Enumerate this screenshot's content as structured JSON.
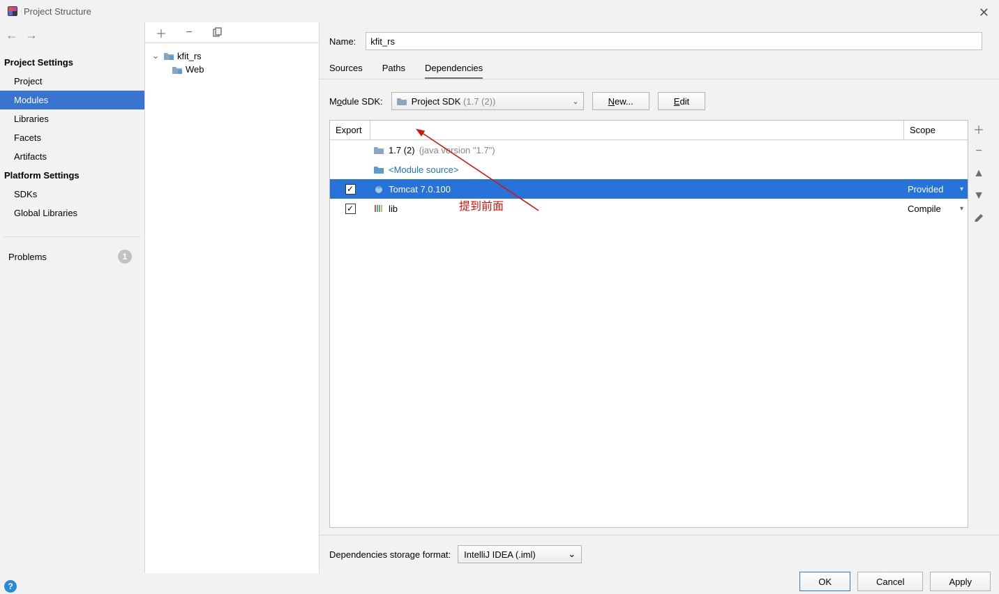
{
  "window": {
    "title": "Project Structure"
  },
  "sidebar": {
    "sections": [
      {
        "title": "Project Settings",
        "items": [
          "Project",
          "Modules",
          "Libraries",
          "Facets",
          "Artifacts"
        ],
        "selected": "Modules"
      },
      {
        "title": "Platform Settings",
        "items": [
          "SDKs",
          "Global Libraries"
        ]
      }
    ],
    "problems": {
      "label": "Problems",
      "count": "1"
    }
  },
  "tree": {
    "root": {
      "label": "kfit_rs",
      "children": [
        {
          "label": "Web"
        }
      ]
    }
  },
  "content": {
    "name_label": "Name:",
    "name_value": "kfit_rs",
    "tabs": [
      "Sources",
      "Paths",
      "Dependencies"
    ],
    "active_tab": "Dependencies",
    "sdk": {
      "label_pre": "M",
      "label_u": "o",
      "label_post": "dule SDK:",
      "select_main": "Project SDK ",
      "select_dim": "(1.7 (2))",
      "new_pre": "",
      "new_u": "N",
      "new_post": "ew...",
      "edit_pre": "",
      "edit_u": "E",
      "edit_post": "dit"
    },
    "dep_table": {
      "headers": {
        "export": "Export",
        "scope": "Scope"
      },
      "rows": [
        {
          "checked": false,
          "export_visible": false,
          "name_main": "1.7 (2) ",
          "name_dim": "(java version \"1.7\")",
          "scope": "",
          "selected": false,
          "link": false,
          "icon": "folder"
        },
        {
          "checked": false,
          "export_visible": false,
          "name_main": "<Module source>",
          "name_dim": "",
          "scope": "",
          "selected": false,
          "link": true,
          "icon": "folder-blue"
        },
        {
          "checked": true,
          "export_visible": true,
          "name_main": "Tomcat 7.0.100",
          "name_dim": "",
          "scope": "Provided",
          "selected": true,
          "link": false,
          "icon": "tomcat"
        },
        {
          "checked": true,
          "export_visible": true,
          "name_main": "lib",
          "name_dim": "",
          "scope": "Compile",
          "selected": false,
          "link": false,
          "icon": "bars"
        }
      ]
    },
    "annotation_text": "提到前面",
    "storage": {
      "label": "Dependencies storage format:",
      "value": "IntelliJ IDEA (.iml)"
    }
  },
  "buttons": {
    "ok": "OK",
    "cancel": "Cancel",
    "apply": "Apply"
  }
}
